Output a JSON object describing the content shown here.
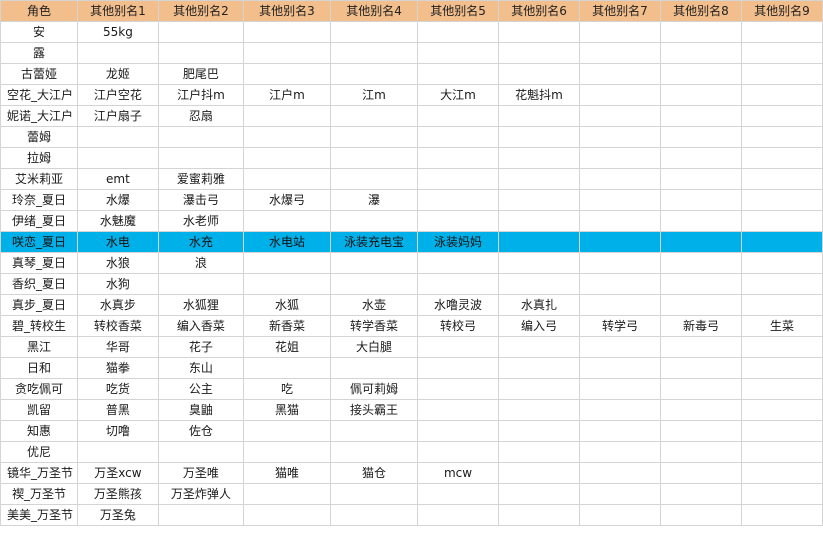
{
  "sheet": {
    "headers": [
      "角色",
      "其他别名1",
      "其他别名2",
      "其他别名3",
      "其他别名4",
      "其他别名5",
      "其他别名6",
      "其他别名7",
      "其他别名8",
      "其他别名9"
    ],
    "selected_row": 10,
    "highlight_color": "#00b0e8",
    "header_color": "#f2be8c",
    "rows": [
      [
        "安",
        "55kg",
        "",
        "",
        "",
        "",
        "",
        "",
        "",
        ""
      ],
      [
        "露",
        "",
        "",
        "",
        "",
        "",
        "",
        "",
        "",
        ""
      ],
      [
        "古蕾娅",
        "龙姬",
        "肥尾巴",
        "",
        "",
        "",
        "",
        "",
        "",
        ""
      ],
      [
        "空花_大江户",
        "江户空花",
        "江户抖m",
        "江户m",
        "江m",
        "大江m",
        "花魁抖m",
        "",
        "",
        ""
      ],
      [
        "妮诺_大江户",
        "江户扇子",
        "忍扇",
        "",
        "",
        "",
        "",
        "",
        "",
        ""
      ],
      [
        "蕾姆",
        "",
        "",
        "",
        "",
        "",
        "",
        "",
        "",
        ""
      ],
      [
        "拉姆",
        "",
        "",
        "",
        "",
        "",
        "",
        "",
        "",
        ""
      ],
      [
        "艾米莉亚",
        "emt",
        "爱蜜莉雅",
        "",
        "",
        "",
        "",
        "",
        "",
        ""
      ],
      [
        "玲奈_夏日",
        "水爆",
        "瀑击弓",
        "水爆弓",
        "瀑",
        "",
        "",
        "",
        "",
        ""
      ],
      [
        "伊绪_夏日",
        "水魅魔",
        "水老师",
        "",
        "",
        "",
        "",
        "",
        "",
        ""
      ],
      [
        "咲恋_夏日",
        "水电",
        "水充",
        "水电站",
        "泳装充电宝",
        "泳装妈妈",
        "",
        "",
        "",
        ""
      ],
      [
        "真琴_夏日",
        "水狼",
        "浪",
        "",
        "",
        "",
        "",
        "",
        "",
        ""
      ],
      [
        "香织_夏日",
        "水狗",
        "",
        "",
        "",
        "",
        "",
        "",
        "",
        ""
      ],
      [
        "真步_夏日",
        "水真步",
        "水狐狸",
        "水狐",
        "水壶",
        "水噜灵波",
        "水真扎",
        "",
        "",
        ""
      ],
      [
        "碧_转校生",
        "转校香菜",
        "编入香菜",
        "新香菜",
        "转学香菜",
        "转校弓",
        "编入弓",
        "转学弓",
        "新毒弓",
        "生菜"
      ],
      [
        "黑江",
        "华哥",
        "花子",
        "花姐",
        "大白腿",
        "",
        "",
        "",
        "",
        ""
      ],
      [
        "日和",
        "猫拳",
        "东山",
        "",
        "",
        "",
        "",
        "",
        "",
        ""
      ],
      [
        "贪吃佩可",
        "吃货",
        "公主",
        "吃",
        "佩可莉姆",
        "",
        "",
        "",
        "",
        ""
      ],
      [
        "凯留",
        "普黑",
        "臭鼬",
        "黑猫",
        "接头霸王",
        "",
        "",
        "",
        "",
        ""
      ],
      [
        "知惠",
        "切噜",
        "佐仓",
        "",
        "",
        "",
        "",
        "",
        "",
        ""
      ],
      [
        "优尼",
        "",
        "",
        "",
        "",
        "",
        "",
        "",
        "",
        ""
      ],
      [
        "镜华_万圣节",
        "万圣xcw",
        "万圣唯",
        "猫唯",
        "猫仓",
        "mcw",
        "",
        "",
        "",
        ""
      ],
      [
        "禊_万圣节",
        "万圣熊孩",
        "万圣炸弹人",
        "",
        "",
        "",
        "",
        "",
        "",
        ""
      ],
      [
        "美美_万圣节",
        "万圣兔",
        "",
        "",
        "",
        "",
        "",
        "",
        "",
        ""
      ]
    ]
  }
}
